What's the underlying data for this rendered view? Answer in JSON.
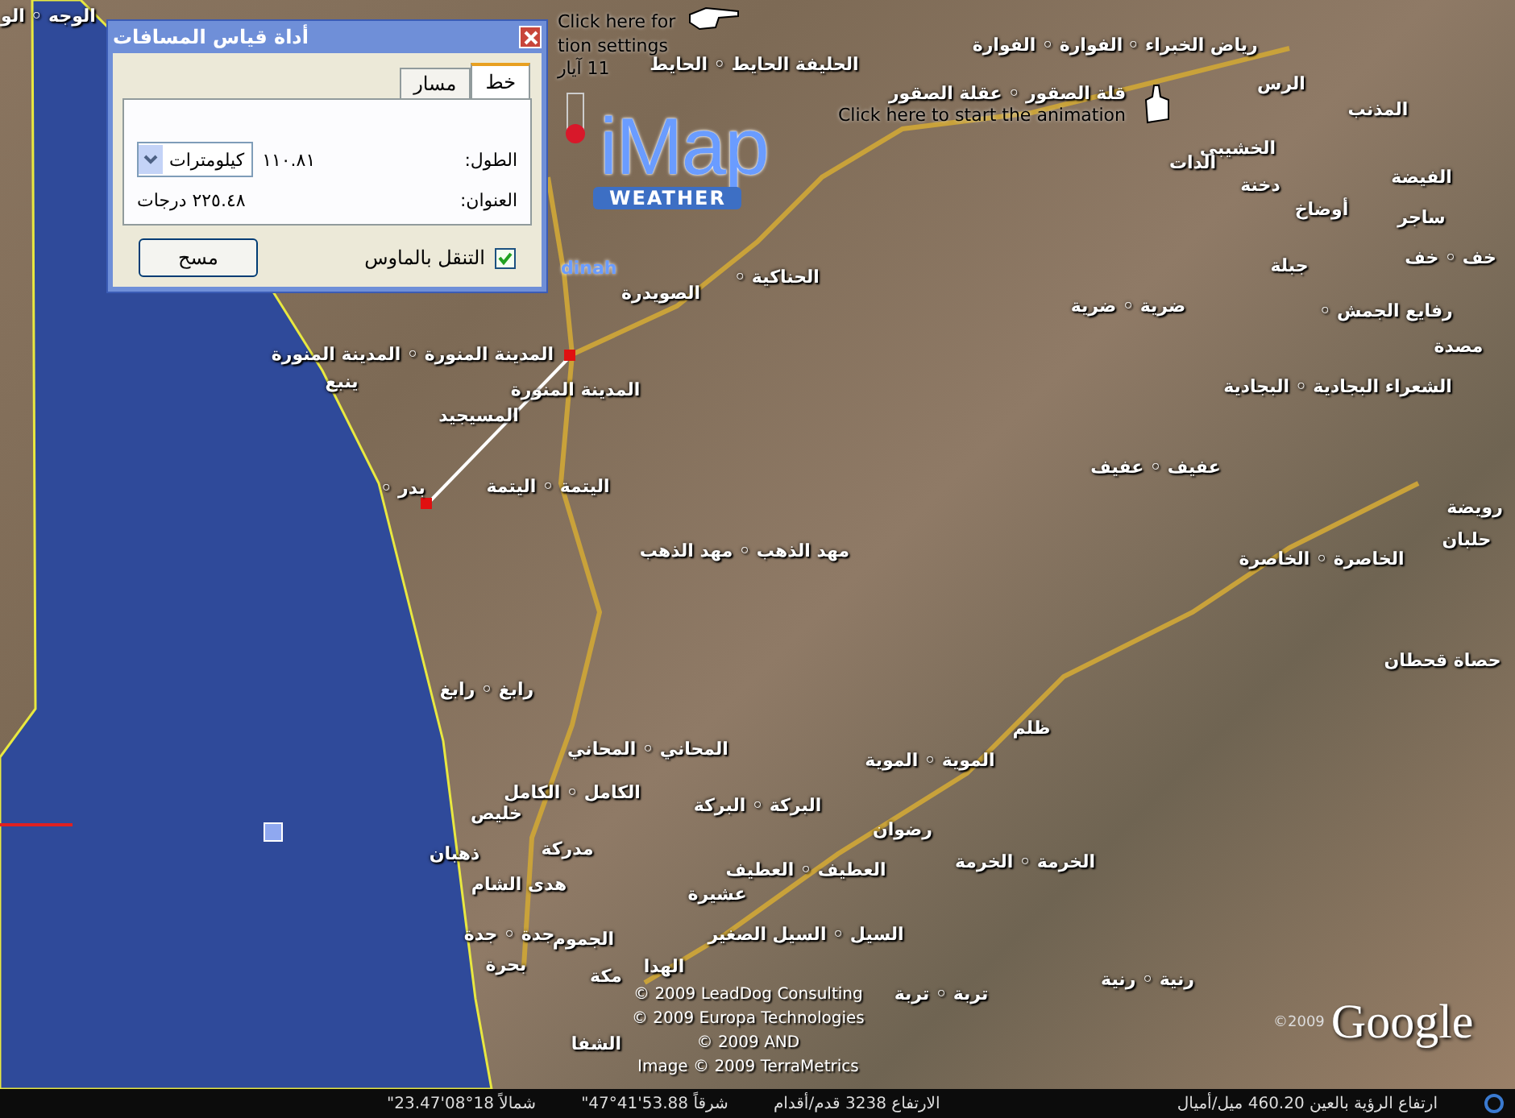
{
  "dialog": {
    "title": "أداة قياس المسافات",
    "tabs": [
      {
        "label": "خط",
        "selected": true
      },
      {
        "label": "مسار",
        "selected": false
      }
    ],
    "fields": [
      {
        "kind": "dropdown",
        "label": "الطول:",
        "value": "١١٠.٨١",
        "unit": "كيلومترات"
      },
      {
        "kind": "text",
        "label": "العنوان:",
        "value": "٢٢٥.٤٨ درجات"
      }
    ],
    "mouse_nav": {
      "label": "التنقل بالماوس",
      "checked": true
    },
    "clear_button": "مسح"
  },
  "overlay": {
    "settings_hint": [
      "Click here for",
      "tion settings"
    ],
    "date": "11 آيار",
    "animation_hint": "Click here to start the animation",
    "logo_main": "iMap",
    "logo_sub": "WEATHER",
    "cut_label": "dinah"
  },
  "map_labels": [
    "الوجه ◦ الو",
    "الحليفة الحايط ◦ الحايط",
    "الفوارة ◦ الفوارة",
    "قلة الصقور ◦ عقلة الصقور",
    "رياض الخبراء ◦",
    "الرس",
    "المذنب",
    "الخشيبي",
    "الدات",
    "دخنة",
    "أوضاخ",
    "الفيضة",
    "ساجر",
    "الحناكية ◦",
    "الصويدرة",
    "المدينة المنورة ◦ المدينة المنورة",
    "المدينة المنورة",
    "المسيجيد",
    "ينبع",
    "بدر ◦",
    "اليتمة ◦ اليتمة",
    "مهد الذهب ◦ مهد الذهب",
    "رابغ ◦ رابغ",
    "المحاني ◦ المحاني",
    "الكامل ◦ الكامل",
    "البركة ◦ البركة",
    "خليص",
    "مدركة",
    "ذهبان",
    "هدى الشام",
    "عشيرة",
    "العطيف ◦ العطيف",
    "السيل ◦ السيل الصغير",
    "الجموم",
    "جدة ◦ جدة",
    "الهدا",
    "مكة",
    "بحرة",
    "الشفا",
    "تربة ◦ تربة",
    "رنية ◦ رنية",
    "الخرمة ◦ الخرمة",
    "الموية ◦ الموية",
    "رضوان",
    "ظلم",
    "خف ◦ خف",
    "جبلة",
    "رفايع الجمش ◦",
    "ضرية ◦ ضرية",
    "مصدة",
    "الشعراء البجادية ◦ البجادية",
    "عفيف ◦ عفيف",
    "رويضة",
    "حلبان",
    "الخاصرة ◦ الخاصرة",
    "حصاة قحطان"
  ],
  "copyright": [
    "© 2009 LeadDog Consulting",
    "© 2009 Europa Technologies",
    "© 2009 AND",
    "Image © 2009 TerraMetrics"
  ],
  "google": {
    "year": "©2009",
    "logo": "Google"
  },
  "status_bar": {
    "latitude": "شمالاً 18°08'23.47\"",
    "longitude": "شرقاً 53.88'41°47\"",
    "elevation": "الارتفاع 3238 قدم/أقدام",
    "eye_altitude": "ارتفاع الرؤية بالعين 460.20 ميل/أميال"
  }
}
